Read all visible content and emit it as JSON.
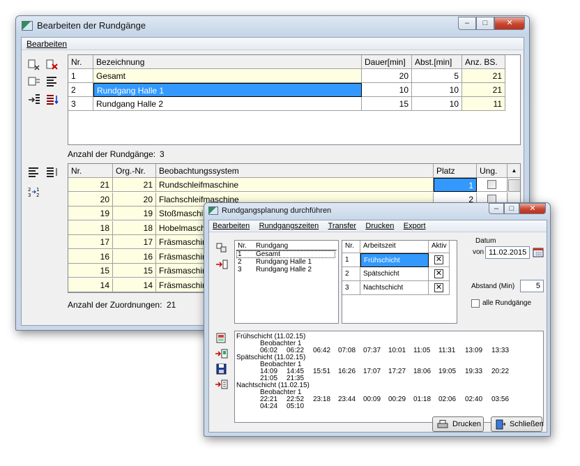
{
  "main_window": {
    "title": "Bearbeiten der Rundgänge",
    "menu": [
      "Bearbeiten"
    ],
    "rundgaenge_table": {
      "headers": [
        "Nr.",
        "Bezeichnung",
        "Dauer[min]",
        "Abst.[min]",
        "Anz. BS."
      ],
      "rows": [
        {
          "nr": "1",
          "name": "Gesamt",
          "dauer": "20",
          "abst": "5",
          "anz": "21"
        },
        {
          "nr": "2",
          "name": "Rundgang Halle 1",
          "dauer": "10",
          "abst": "10",
          "anz": "21"
        },
        {
          "nr": "3",
          "name": "Rundgang Halle 2",
          "dauer": "15",
          "abst": "10",
          "anz": "11"
        }
      ]
    },
    "count_rundgaenge_label": "Anzahl der Rundgänge:",
    "count_rundgaenge_value": "3",
    "zuordnung_table": {
      "headers": [
        "Nr.",
        "Org.-Nr.",
        "Beobachtungssystem",
        "Platz",
        "Ung."
      ],
      "rows": [
        {
          "nr": "21",
          "org": "21",
          "system": "Rundschleifmaschine",
          "platz": "1"
        },
        {
          "nr": "20",
          "org": "20",
          "system": "Flachschleifmaschine",
          "platz": "2"
        },
        {
          "nr": "19",
          "org": "19",
          "system": "Stoßmaschine",
          "platz": ""
        },
        {
          "nr": "18",
          "org": "18",
          "system": "Hobelmaschine",
          "platz": ""
        },
        {
          "nr": "17",
          "org": "17",
          "system": "Fräsmaschine",
          "platz": ""
        },
        {
          "nr": "16",
          "org": "16",
          "system": "Fräsmaschine",
          "platz": ""
        },
        {
          "nr": "15",
          "org": "15",
          "system": "Fräsmaschine",
          "platz": ""
        },
        {
          "nr": "14",
          "org": "14",
          "system": "Fräsmaschine",
          "platz": ""
        }
      ]
    },
    "count_zuordnungen_label": "Anzahl der Zuordnungen:",
    "count_zuordnungen_value": "21"
  },
  "dialog": {
    "title": "Rundgangsplanung durchführen",
    "menu": [
      "Bearbeiten",
      "Rundgangszeiten",
      "Transfer",
      "Drucken",
      "Export"
    ],
    "rundgang_list": {
      "headers": [
        "Nr.",
        "Rundgang"
      ],
      "rows": [
        {
          "nr": "1",
          "name": "Gesamt"
        },
        {
          "nr": "2",
          "name": "Rundgang Halle 1"
        },
        {
          "nr": "3",
          "name": "Rundgang Halle 2"
        }
      ]
    },
    "schicht_table": {
      "headers": [
        "Nr.",
        "Arbeitszeit",
        "Aktiv"
      ],
      "rows": [
        {
          "nr": "1",
          "name": "Frühschicht"
        },
        {
          "nr": "2",
          "name": "Spätschicht"
        },
        {
          "nr": "3",
          "name": "Nachtschicht"
        }
      ]
    },
    "datum_label": "Datum",
    "von_label": "von",
    "datum_value": "11.02.2015",
    "abstand_label": "Abstand (Min)",
    "abstand_value": "5",
    "alle_label": "alle Rundgänge",
    "output": [
      {
        "title": "Frühschicht (11.02.15)",
        "observer": "Beobachter 1",
        "line1": [
          "06:02",
          "06:22",
          "06:42",
          "07:08",
          "07:37",
          "10:01",
          "11:05",
          "11:31",
          "13:09",
          "13:33"
        ],
        "line2": []
      },
      {
        "title": "Spätschicht (11.02.15)",
        "observer": "Beobachter 1",
        "line1": [
          "14:09",
          "14:45",
          "15:51",
          "16:26",
          "17:07",
          "17:27",
          "18:06",
          "19:05",
          "19:33",
          "20:22"
        ],
        "line2": [
          "21:05",
          "21:35"
        ]
      },
      {
        "title": "Nachtschicht (11.02.15)",
        "observer": "Beobachter 1",
        "line1": [
          "22:21",
          "22:52",
          "23:18",
          "23:44",
          "00:09",
          "00:29",
          "01:18",
          "02:06",
          "02:40",
          "03:56"
        ],
        "line2": [
          "04:24",
          "05:10"
        ]
      }
    ],
    "btn_drucken": "Drucken",
    "btn_schliessen": "Schließen"
  }
}
